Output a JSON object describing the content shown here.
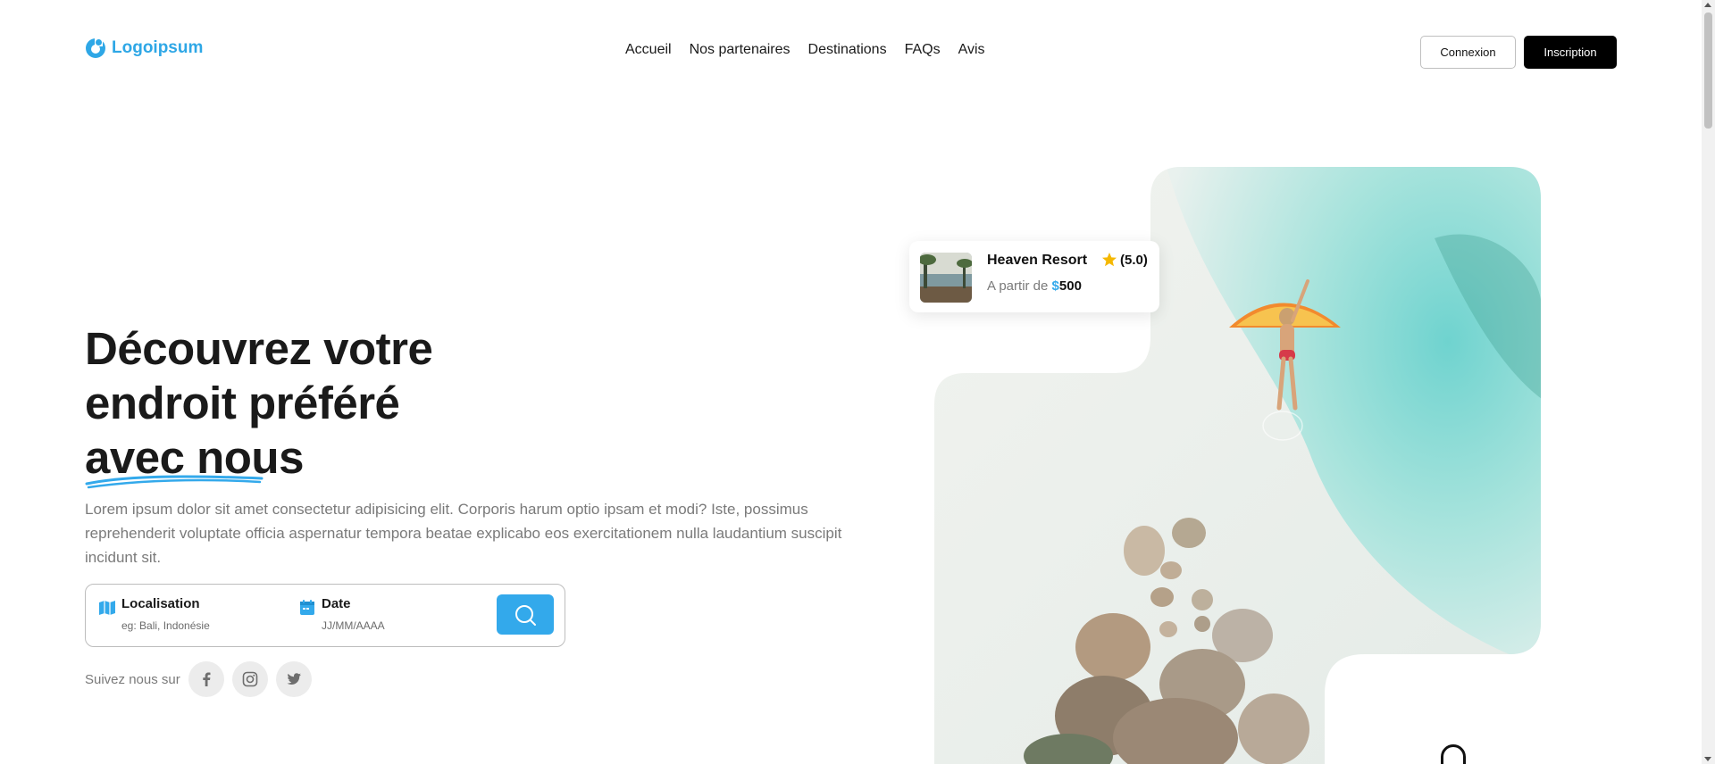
{
  "brand": {
    "name": "Logoipsum",
    "accent": "#2ea7e6"
  },
  "nav": {
    "items": [
      {
        "label": "Accueil"
      },
      {
        "label": "Nos partenaires"
      },
      {
        "label": "Destinations"
      },
      {
        "label": "FAQs"
      },
      {
        "label": "Avis"
      }
    ]
  },
  "auth": {
    "login_label": "Connexion",
    "signup_label": "Inscription"
  },
  "hero": {
    "title_line1": "Découvrez votre",
    "title_line2": "endroit préféré",
    "title_line3": "avec nous",
    "description": "Lorem ipsum dolor sit amet consectetur adipisicing elit. Corporis harum optio ipsam et modi? Iste, possimus reprehenderit voluptate officia aspernatur tempora beatae explicabo eos exercitationem nulla laudantium suscipit incidunt sit."
  },
  "search": {
    "location": {
      "label": "Localisation",
      "placeholder": "eg: Bali, Indonésie",
      "icon": "map-icon"
    },
    "date": {
      "label": "Date",
      "placeholder": "JJ/MM/AAAA",
      "icon": "calendar-icon"
    },
    "button_icon": "search-icon",
    "button_color": "#33a9eb"
  },
  "social": {
    "label": "Suivez nous sur",
    "items": [
      {
        "icon": "facebook-icon"
      },
      {
        "icon": "instagram-icon"
      },
      {
        "icon": "twitter-icon"
      }
    ]
  },
  "resort_card": {
    "name": "Heaven Resort",
    "rating": "(5.0)",
    "price_prefix": "A partir de",
    "currency": "$",
    "amount": "500"
  }
}
